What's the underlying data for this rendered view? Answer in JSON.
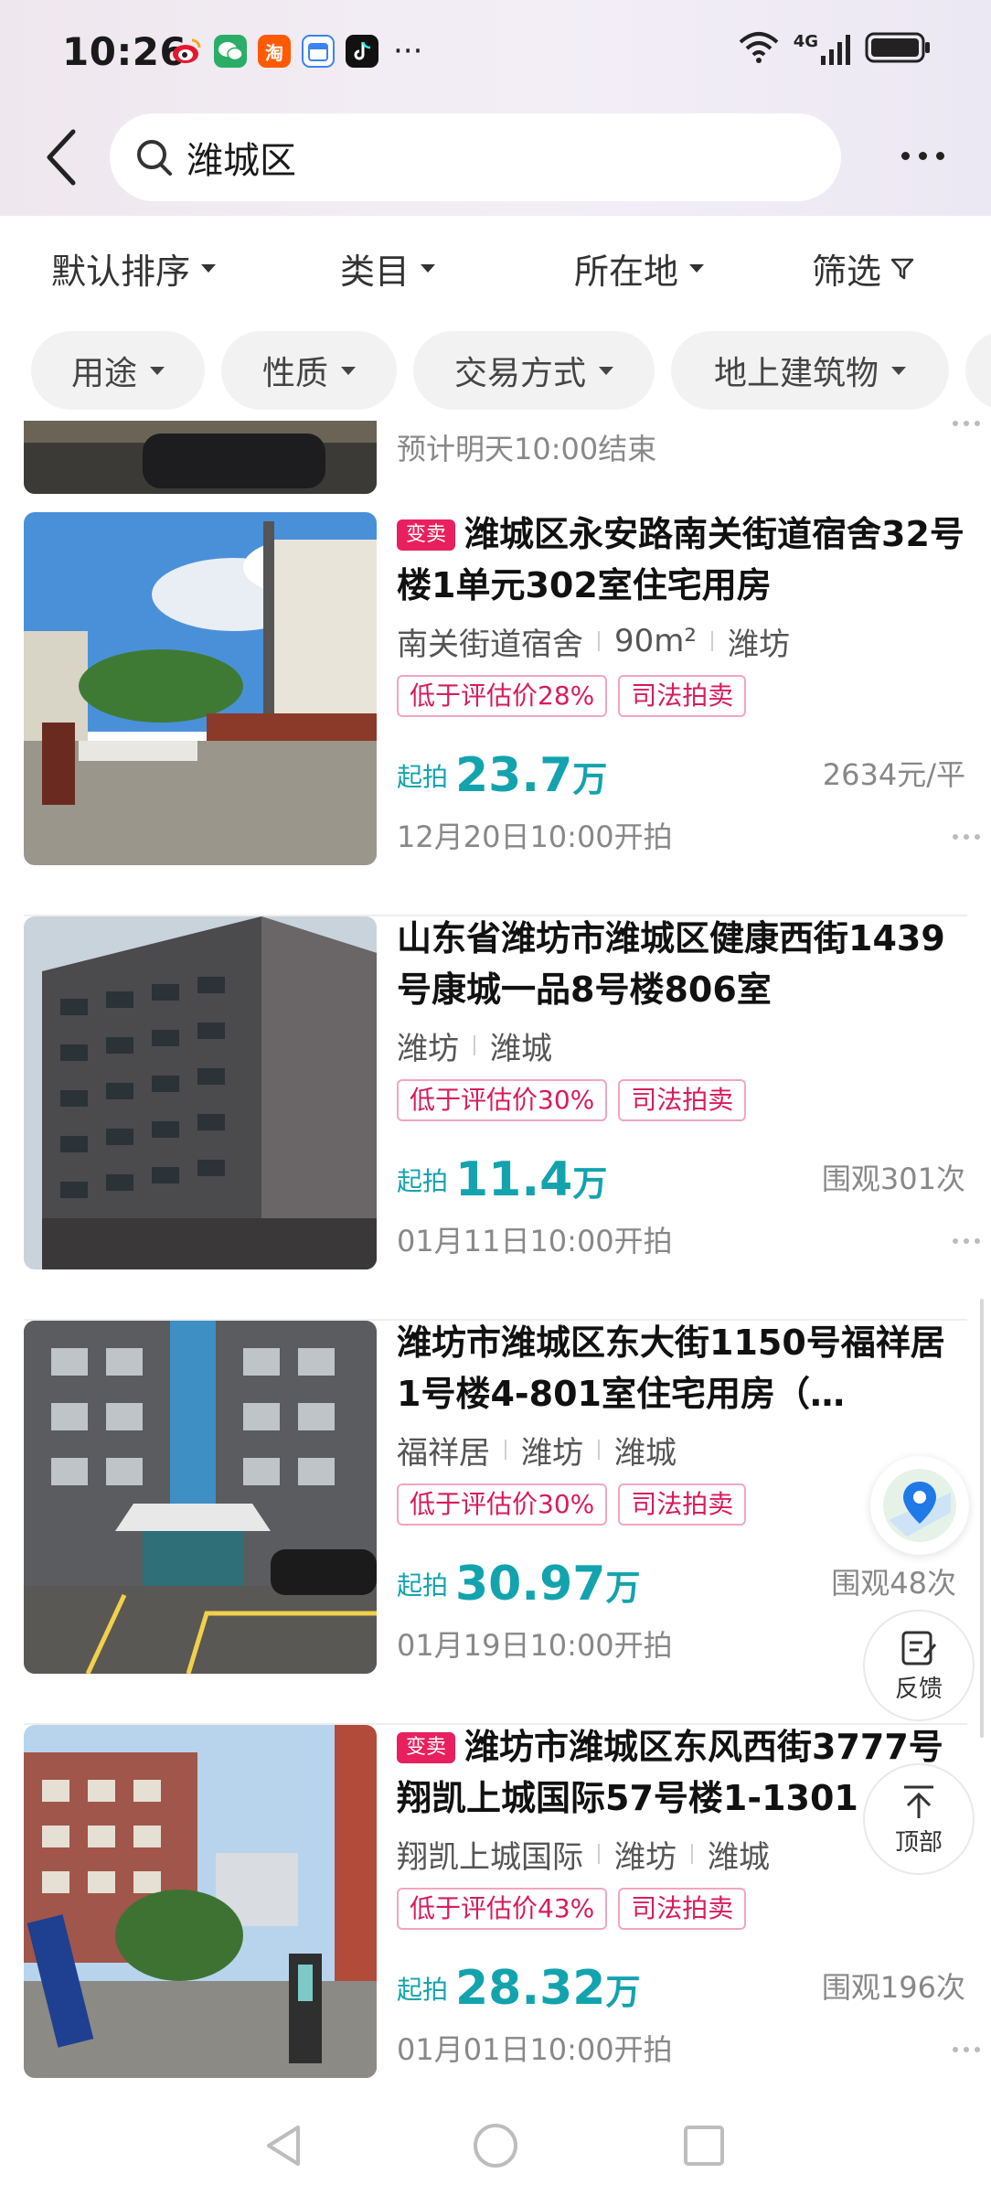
{
  "status_bar": {
    "time": "10:26",
    "apps": [
      {
        "icon": "weibo-icon",
        "color": "#f5a623"
      },
      {
        "icon": "wechat-icon",
        "color": "#2aae67"
      },
      {
        "icon": "taobao-icon",
        "color": "#ff5a00",
        "text": "淘"
      },
      {
        "icon": "calendar-icon",
        "color": "#3b82f6"
      },
      {
        "icon": "tiktok-icon",
        "color": "#111111"
      }
    ],
    "more": "···",
    "network": "4G"
  },
  "header": {
    "search_text": "潍城区"
  },
  "sort_bar": [
    {
      "label": "默认排序"
    },
    {
      "label": "类目"
    },
    {
      "label": "所在地"
    },
    {
      "label": "筛选"
    }
  ],
  "chips": [
    {
      "label": "用途"
    },
    {
      "label": "性质"
    },
    {
      "label": "交易方式"
    },
    {
      "label": "地上建筑物"
    }
  ],
  "partial_card": {
    "end_text": "预计明天10:00结束"
  },
  "listings": [
    {
      "badge": "变卖",
      "title": "潍城区永安路南关街道宿舍32号楼1单元302室住宅用房",
      "meta": [
        "南关街道宿舍",
        "90m²",
        "潍坊"
      ],
      "tags": [
        "低于评估价28%",
        "司法拍卖"
      ],
      "price_label": "起拍",
      "price": "23.7",
      "unit": "万",
      "side": "2634元/平",
      "start_time": "12月20日10:00开拍"
    },
    {
      "badge": "",
      "title": "山东省潍坊市潍城区健康西街1439号康城一品8号楼806室",
      "meta": [
        "潍坊",
        "潍城"
      ],
      "tags": [
        "低于评估价30%",
        "司法拍卖"
      ],
      "price_label": "起拍",
      "price": "11.4",
      "unit": "万",
      "side": "围观301次",
      "start_time": "01月11日10:00开拍"
    },
    {
      "badge": "",
      "title": "潍坊市潍城区东大街1150号福祥居1号楼4-801室住宅用房（…",
      "meta": [
        "福祥居",
        "潍坊",
        "潍城"
      ],
      "tags": [
        "低于评估价30%",
        "司法拍卖"
      ],
      "price_label": "起拍",
      "price": "30.97",
      "unit": "万",
      "side": "围观48次",
      "start_time": "01月19日10:00开拍"
    },
    {
      "badge": "变卖",
      "title": "潍坊市潍城区东风西街3777号翔凯上城国际57号楼1-1301",
      "meta": [
        "翔凯上城国际",
        "潍坊",
        "潍城"
      ],
      "tags": [
        "低于评估价43%",
        "司法拍卖"
      ],
      "price_label": "起拍",
      "price": "28.32",
      "unit": "万",
      "side": "围观196次",
      "start_time": "01月01日10:00开拍"
    }
  ],
  "floating": {
    "feedback": "反馈",
    "top": "顶部"
  },
  "colors": {
    "accent_price": "#13a3ae",
    "tag_red": "#d81b5c",
    "badge_red": "#e8205f"
  }
}
